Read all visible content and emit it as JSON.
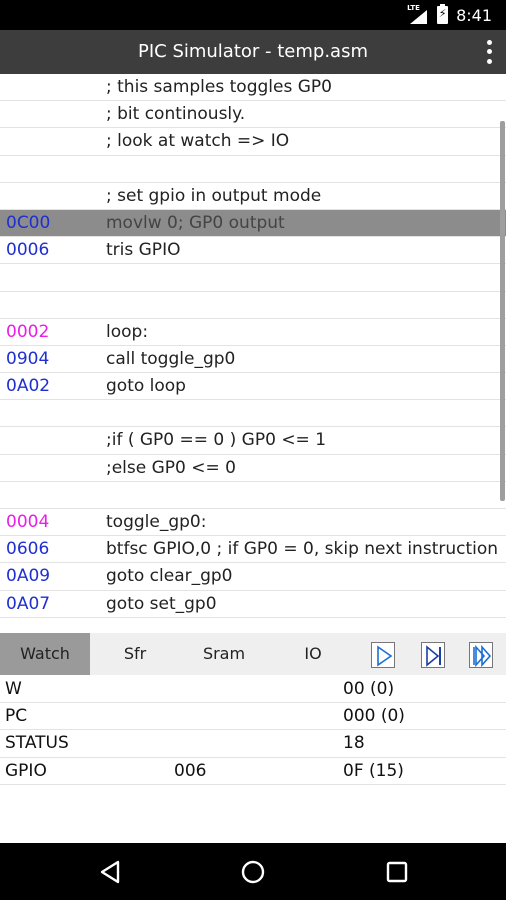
{
  "status_bar": {
    "network": "LTE",
    "time": "8:41"
  },
  "app": {
    "title": "PIC Simulator - temp.asm"
  },
  "colors": {
    "addr_blue": "#1f2fd0",
    "addr_magenta": "#e81ee8",
    "action_bar": "#3d3d3d",
    "current_line": "#8c8c8c"
  },
  "code": {
    "lines": [
      {
        "addr": "",
        "text": "; this samples toggles GP0"
      },
      {
        "addr": "",
        "text": "; bit continously."
      },
      {
        "addr": "",
        "text": "; look at watch => IO"
      },
      {
        "addr": "",
        "text": ""
      },
      {
        "addr": "",
        "text": "; set gpio in output mode"
      },
      {
        "addr": "0C00",
        "text": "movlw   0; GP0 output",
        "current": true
      },
      {
        "addr": "0006",
        "text": "tris GPIO"
      },
      {
        "addr": "",
        "text": ""
      },
      {
        "addr": "",
        "text": ""
      },
      {
        "addr": "0002",
        "text": "loop:",
        "label": true
      },
      {
        "addr": "0904",
        "text": "call toggle_gp0"
      },
      {
        "addr": "0A02",
        "text": "goto loop"
      },
      {
        "addr": "",
        "text": ""
      },
      {
        "addr": "",
        "text": ";if ( GP0 == 0 ) GP0 <= 1"
      },
      {
        "addr": "",
        "text": ";else GP0 <= 0"
      },
      {
        "addr": "",
        "text": ""
      },
      {
        "addr": "0004",
        "text": "toggle_gp0:",
        "label": true
      },
      {
        "addr": "0606",
        "text": "btfsc GPIO,0 ; if GP0 = 0, skip next instruction"
      },
      {
        "addr": "0A09",
        "text": "goto clear_gp0"
      },
      {
        "addr": "0A07",
        "text": "goto set_gp0"
      }
    ]
  },
  "tabs": {
    "watch": "Watch",
    "sfr": "Sfr",
    "sram": "Sram",
    "io": "IO",
    "active": "Watch"
  },
  "controls": {
    "run": "play-icon",
    "step": "step-icon",
    "fast": "fast-forward-icon"
  },
  "watch": {
    "rows": [
      {
        "name": "W",
        "addr": "",
        "value": "00 (0)"
      },
      {
        "name": "PC",
        "addr": "",
        "value": "000 (0)"
      },
      {
        "name": "STATUS",
        "addr": "",
        "value": "18"
      },
      {
        "name": "GPIO",
        "addr": "006",
        "value": "0F (15)"
      }
    ]
  }
}
